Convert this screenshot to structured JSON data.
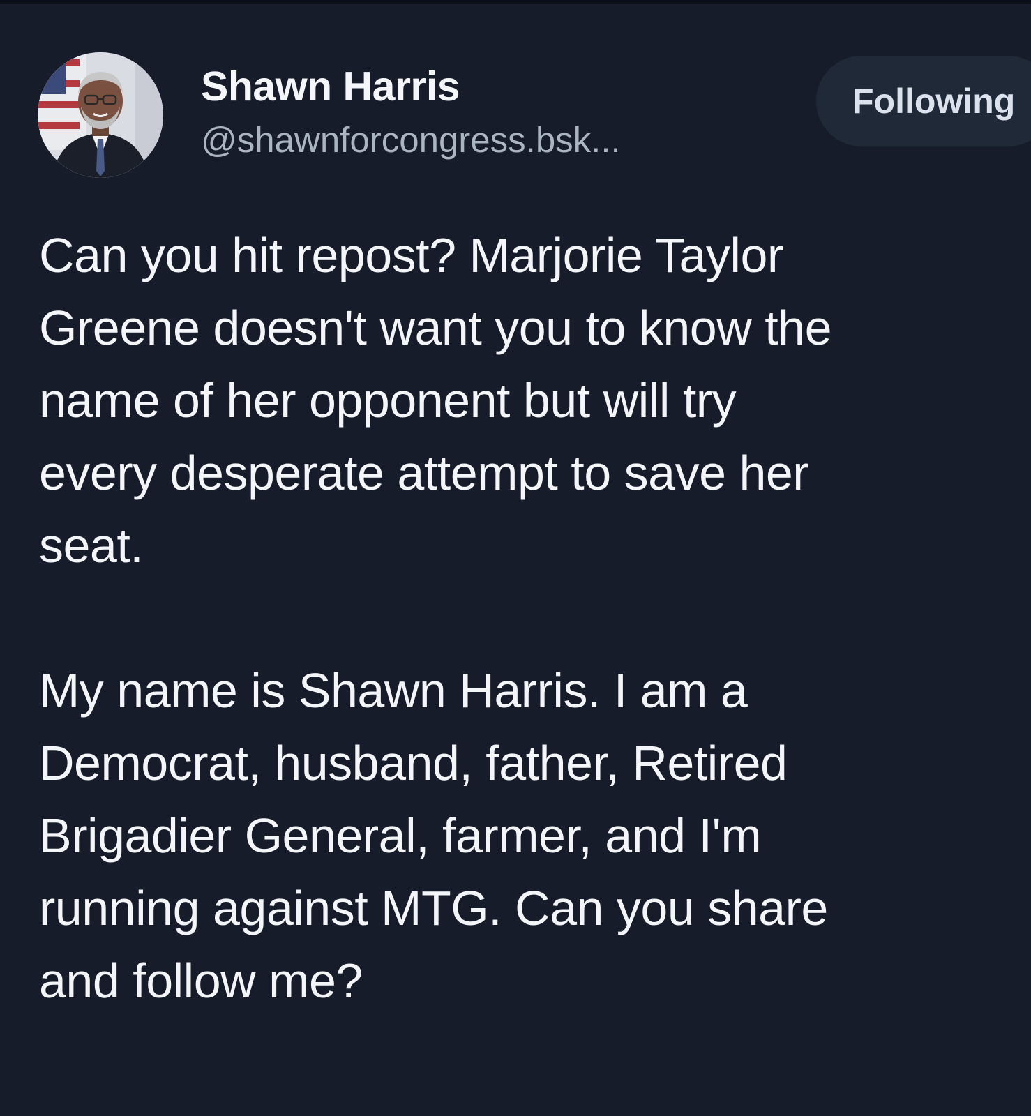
{
  "post": {
    "author": {
      "display_name": "Shawn Harris",
      "handle": "@shawnforcongress.bsk..."
    },
    "follow_button_label": "Following",
    "body": {
      "paragraph_1": [
        "Can you hit repost? Marjorie Taylor",
        "Greene doesn't want you to know the",
        "name of her opponent but will try",
        "every desperate attempt to save her",
        "seat."
      ],
      "paragraph_2": [
        "My name is Shawn Harris. I am a",
        "Democrat, husband, father, Retired",
        "Brigadier General, farmer, and I'm",
        "running against MTG. Can you share",
        "and follow me?"
      ]
    }
  },
  "colors": {
    "background": "#161c29",
    "text_primary": "#f3f5f8",
    "text_secondary": "#aab4c3",
    "button_background": "#202938"
  }
}
